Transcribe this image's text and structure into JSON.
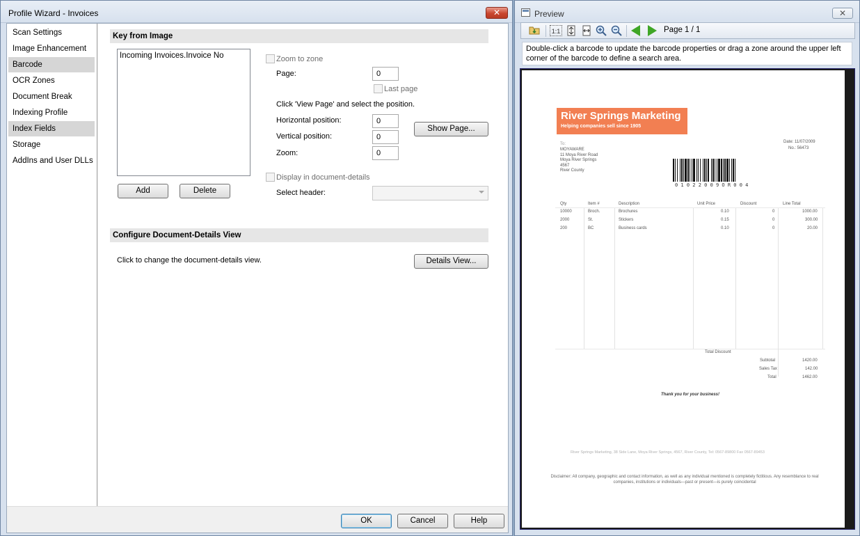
{
  "wizard": {
    "title": "Profile Wizard - Invoices",
    "close_glyph": "✕",
    "nav": [
      {
        "label": "Scan Settings",
        "selected": false
      },
      {
        "label": "Image Enhancement",
        "selected": false
      },
      {
        "label": "Barcode",
        "selected": true
      },
      {
        "label": "OCR Zones",
        "selected": false
      },
      {
        "label": "Document Break",
        "selected": false
      },
      {
        "label": "Indexing Profile",
        "selected": false
      },
      {
        "label": "Index Fields",
        "selected": true
      },
      {
        "label": "Storage",
        "selected": false
      },
      {
        "label": "AddIns and User DLLs",
        "selected": false
      }
    ],
    "key_section": {
      "heading": "Key from Image",
      "list_items": [
        "Incoming Invoices.Invoice No"
      ],
      "add_label": "Add",
      "delete_label": "Delete",
      "zoom_to_zone_label": "Zoom to zone",
      "page_label": "Page:",
      "page_value": "0",
      "last_page_label": "Last page",
      "instruction": "Click 'View Page' and select the position.",
      "horizontal_label": "Horizontal position:",
      "horizontal_value": "0",
      "vertical_label": "Vertical position:",
      "vertical_value": "0",
      "zoom_label": "Zoom:",
      "zoom_value": "0",
      "show_page_label": "Show Page...",
      "display_details_label": "Display in document-details",
      "select_header_label": "Select header:",
      "select_header_value": ""
    },
    "details_section": {
      "heading": "Configure Document-Details View",
      "text": "Click to change the document-details view.",
      "button_label": "Details View..."
    },
    "footer": {
      "ok_label": "OK",
      "cancel_label": "Cancel",
      "help_label": "Help"
    }
  },
  "preview": {
    "title": "Preview",
    "close_glyph": "✕",
    "page_indicator": "Page 1 / 1",
    "toolbar_icons": [
      "open-icon",
      "actual-size-icon",
      "fit-page-icon",
      "fit-width-icon",
      "zoom-in-icon",
      "zoom-out-icon",
      "previous-page-icon",
      "next-page-icon"
    ],
    "hint": "Double-click a barcode to update the barcode properties or drag a zone around the upper left corner of the barcode to define a search area.",
    "document": {
      "logo_title": "River Springs Marketing",
      "logo_tagline": "Helping companies sell since 1905",
      "to_label": "To:",
      "to_lines": [
        "MOYAWARE",
        "11 Moya River Road",
        "Moya River Springs",
        "4567",
        "River County"
      ],
      "date_line": "Date: 11/07/2009",
      "no_line": "No.: 56473",
      "barcode_text": "0 1 0 2 2 0 0 9 O R 0 0 4",
      "headers": [
        "Qty",
        "Item #",
        "Description",
        "Unit Price",
        "Discount",
        "Line Total"
      ],
      "rows": [
        [
          "10000",
          "Broch.",
          "Brochures",
          "0.10",
          "0",
          "1000.00"
        ],
        [
          "2000",
          "St.",
          "Stickers",
          "0.15",
          "0",
          "300.00"
        ],
        [
          "200",
          "BC",
          "Business cards",
          "0.10",
          "0",
          "20.00"
        ]
      ],
      "total_discount_label": "Total Discount",
      "subtotal_label": "Subtotal",
      "subtotal_value": "1420.00",
      "sales_tax_label": "Sales Tax",
      "sales_tax_value": "142.00",
      "total_label": "Total",
      "total_value": "1462.00",
      "thanks": "Thank you for your business!",
      "footer_address": "River Springs Marketing, 38 Side Lane, Moya River Springs, 4567, River County, Tel: 0567-89800 Fax 0567-89453",
      "disclaimer": "Disclaimer: All company, geographic and contact information, as well as any individual mentioned is completely fictitious. Any resemblance to real companies, institutions or individuals—past or present—is purely coincidental"
    }
  }
}
